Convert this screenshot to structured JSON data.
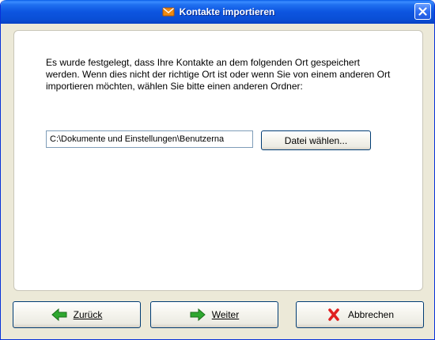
{
  "window": {
    "title": "Kontakte importieren",
    "title_icon": "envelope-icon",
    "close_icon": "close-icon"
  },
  "content": {
    "description": "Es wurde festgelegt, dass Ihre Kontakte an dem folgenden Ort gespeichert werden. Wenn dies nicht der richtige Ort ist oder wenn Sie von einem anderen Ort importieren möchten, wählen Sie bitte einen anderen Ordner:",
    "path_value": "C:\\Dokumente und Einstellungen\\Benutzerna",
    "browse_label": "Datei wählen..."
  },
  "footer": {
    "back_label": "Zurück",
    "back_icon": "arrow-left-icon",
    "next_label": "Weiter",
    "next_icon": "arrow-right-icon",
    "cancel_label": "Abbrechen",
    "cancel_icon": "red-x-icon"
  },
  "colors": {
    "titlebar": "#0a4fd6",
    "window_bg": "#ece9d8",
    "arrow_green": "#2fa82f",
    "cancel_red": "#e02020",
    "title_icon_orange": "#f08a10"
  }
}
